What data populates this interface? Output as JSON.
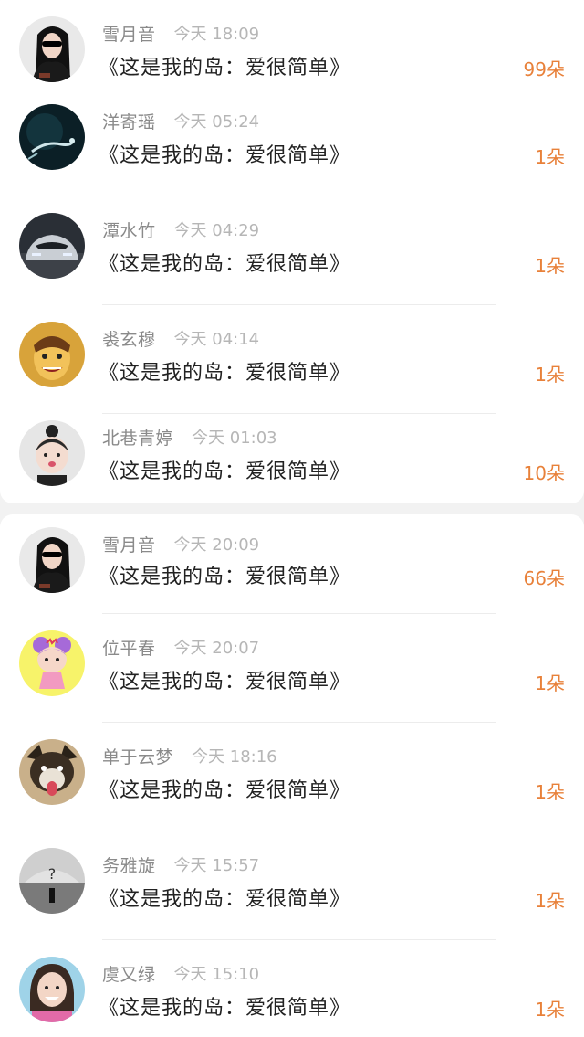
{
  "card1": {
    "rows": [
      {
        "name": "雪月音",
        "time": "今天 18:09",
        "text": "《这是我的岛：爱很简单》",
        "count": "99朵",
        "avatar": "avatar-woman-sunglasses"
      },
      {
        "name": "洋寄瑶",
        "time": "今天 05:24",
        "text": "《这是我的岛：爱很简单》",
        "count": "1朵",
        "avatar": "avatar-underwater-swimmer"
      },
      {
        "name": "潭水竹",
        "time": "今天 04:29",
        "text": "《这是我的岛：爱很简单》",
        "count": "1朵",
        "avatar": "avatar-sports-car"
      },
      {
        "name": "裘玄穆",
        "time": "今天 04:14",
        "text": "《这是我的岛：爱很简单》",
        "count": "1朵",
        "avatar": "avatar-cartoon-face"
      },
      {
        "name": "北巷青婷",
        "time": "今天 01:03",
        "text": "《这是我的岛：爱很简单》",
        "count": "10朵",
        "avatar": "avatar-little-girl"
      }
    ]
  },
  "card2": {
    "rows": [
      {
        "name": "雪月音",
        "time": "今天 20:09",
        "text": "《这是我的岛：爱很简单》",
        "count": "66朵",
        "avatar": "avatar-woman-sunglasses"
      },
      {
        "name": "位平春",
        "time": "今天 20:07",
        "text": "《这是我的岛：爱很简单》",
        "count": "1朵",
        "avatar": "avatar-cartoon-girl"
      },
      {
        "name": "单于云梦",
        "time": "今天 18:16",
        "text": "《这是我的岛：爱很简单》",
        "count": "1朵",
        "avatar": "avatar-dog"
      },
      {
        "name": "务雅旋",
        "time": "今天 15:57",
        "text": "《这是我的岛：爱很简单》",
        "count": "1朵",
        "avatar": "avatar-monochrome-stage"
      },
      {
        "name": "虞又绿",
        "time": "今天 15:10",
        "text": "《这是我的岛：爱很简单》",
        "count": "1朵",
        "avatar": "avatar-smiling-woman"
      }
    ]
  },
  "colors": {
    "count": "#e8813a",
    "name": "#8a8a8a",
    "time": "#b6b6b6",
    "text": "#222222"
  }
}
